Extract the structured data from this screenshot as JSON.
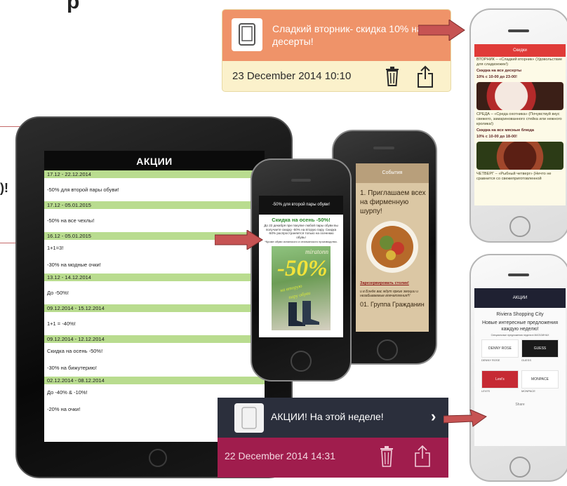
{
  "fragments": {
    "title": "p",
    "left_label": ")!"
  },
  "notification_top": {
    "message": "Сладкий вторник- скидка 10% на десерты!",
    "datetime": "23 December 2014 10:10",
    "trash_icon": "trash-icon",
    "share_icon": "share-icon"
  },
  "notification_bottom": {
    "message": "АКЦИИ! На этой неделе!",
    "datetime": "22 December 2014 14:31",
    "chevron_icon": "chevron-right-icon",
    "trash_icon": "trash-icon",
    "share_icon": "share-icon"
  },
  "ipad": {
    "header": "АКЦИИ",
    "rows": [
      {
        "date": "17.12 - 22.12.2014",
        "items": [
          "-50% для второй пары обуви!"
        ]
      },
      {
        "date": "17.12 - 05.01.2015",
        "items": [
          "-50% на все чехлы!"
        ]
      },
      {
        "date": "16.12 - 05.01.2015",
        "items": [
          "1+1=3!",
          "-30% на модные очки!"
        ]
      },
      {
        "date": "13.12 - 14.12.2014",
        "items": [
          "До -50%!"
        ]
      },
      {
        "date": "09.12.2014 - 15.12.2014",
        "items": [
          "1+1 = -40%!"
        ]
      },
      {
        "date": "09.12.2014 - 12.12.2014",
        "items": [
          "Скидка на осень -50%!",
          "-30% на бижутерию!"
        ]
      },
      {
        "date": "02.12.2014 - 08.12.2014",
        "items": [
          "До -40% & -10%!",
          "-20% на очки!"
        ]
      }
    ]
  },
  "phone_discounts": {
    "header": "Скидки",
    "lines": [
      {
        "text": "ВТОРНИК – «Сладкий вторник» (Удовольствие для сладкоежек!)",
        "bold": false
      },
      {
        "text": "Скидка на все десерты",
        "bold": true
      },
      {
        "text": "10% с 10-00 до 23-00!",
        "bold": true
      }
    ],
    "lines2": [
      {
        "text": "СРЕДА – «Среда охотника» (Почувствуй вкус свежего, замаринованного стейка или нежного кролика!)",
        "bold": false
      },
      {
        "text": "Скидка на все мясные блюда",
        "bold": true
      },
      {
        "text": "10% с 10-00 до 18-00!",
        "bold": true
      }
    ],
    "lines3": [
      {
        "text": "ЧЕТВЕРГ – «Рыбный четверг» (Нечто не сравнится со свежеприготовленной",
        "bold": false
      }
    ]
  },
  "phone_events": {
    "header": "События",
    "text1": "1. Приглашаем всех на фирменную шурпу!",
    "link": "Зарезервировать столик!",
    "text2": "и в Бэнде вас ждут яркие эмоции и незабываемые впечатления!!!",
    "text3": "01. Группа Гражданин"
  },
  "phone_promo": {
    "header": "-50% для второй пары обуви!",
    "title": "Скидка на осень -50%!",
    "body": "До 22 декабря при покупке любой пары обуви вы получаете скидку -50% на вторую пару. Скидка -50% распространяется только на осеннюю обувь!",
    "note": "*Кроме обуви испанского и итальянского производства.",
    "ad_brand": "miratonn",
    "ad_big": "-50%",
    "ad_line1": "на вторую",
    "ad_line2": "пару обуви"
  },
  "phone_mall": {
    "header": "АКЦИИ",
    "mall": "Riviera Shopping City",
    "headline": "Новые интересные предложения каждую неделю!",
    "small": "Специальные предложения недели в МАГАЗИНАХ",
    "tiles": [
      {
        "logo": "DENNY ROSE",
        "cap": "DENNY ROSE"
      },
      {
        "logo": "GUESS",
        "cap": "GUESS"
      },
      {
        "logo": "Levi's",
        "cap": "LEVI'S"
      },
      {
        "logo": "MONPACE",
        "cap": "MONPACE"
      }
    ],
    "share": "Share"
  },
  "colors": {
    "notif_top_bg": "#ef9369",
    "notif_bottom_footer": "#a01d4d",
    "ipad_date_row": "#b9dc8f",
    "arrow": "#c65353"
  }
}
